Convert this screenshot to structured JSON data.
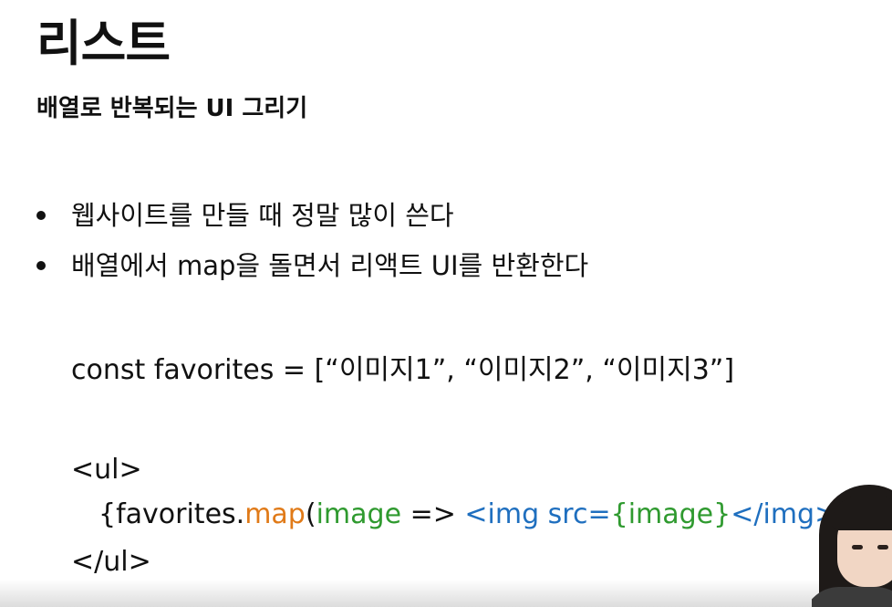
{
  "slide": {
    "title": "리스트",
    "subtitle": "배열로 반복되는 UI 그리기",
    "bullets": [
      "웹사이트를 만들 때 정말 많이 쓴다",
      "배열에서 map을 돌면서 리액트 UI를 반환한다"
    ],
    "code": {
      "const_line": "const favorites = [“이미지1”, “이미지2”, “이미지3”]",
      "ul_open": "<ul>",
      "map_line": {
        "part_open": "{favorites.",
        "part_map": "map",
        "part_paren_open": "(",
        "part_param": "image",
        "part_arrow": " => ",
        "part_jsx_open": "<img src=",
        "part_expr": "{image}",
        "part_jsx_close": "</img>",
        "part_close": ")}"
      },
      "ul_close": "</ul>"
    }
  },
  "colors": {
    "text": "#111111",
    "method": "#e07a18",
    "variable": "#2f9a2f",
    "jsx": "#1f6fbf",
    "background": "#ffffff"
  },
  "presenter": {
    "visible": true
  }
}
